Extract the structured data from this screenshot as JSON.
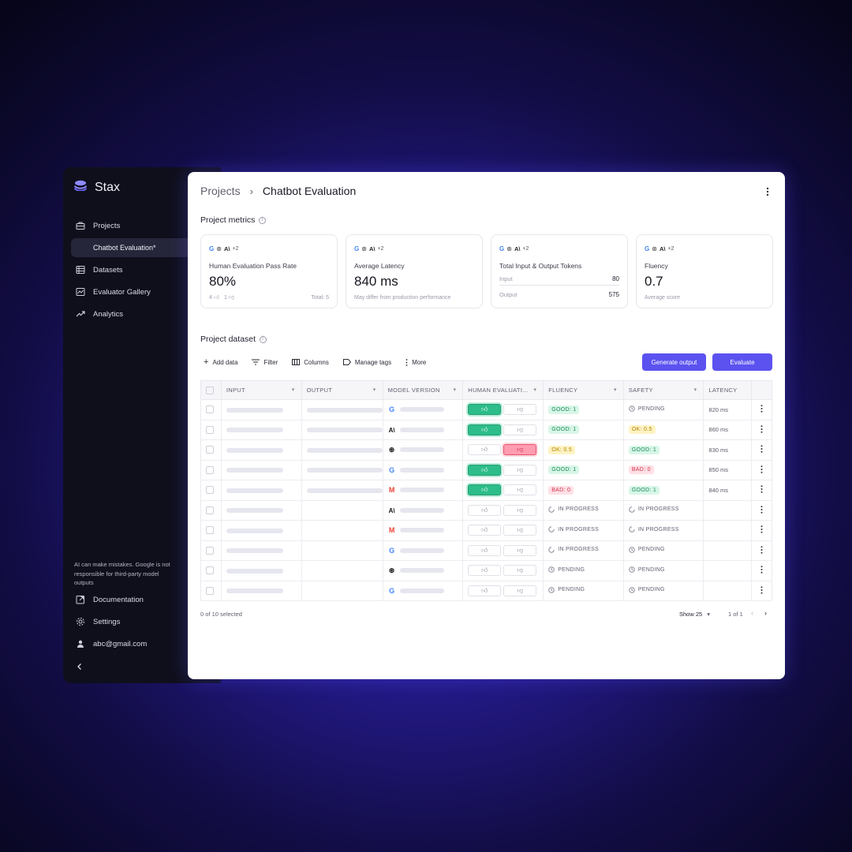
{
  "app": {
    "name": "Stax"
  },
  "sidebar": {
    "items": [
      {
        "label": "Projects",
        "icon": "briefcase-icon"
      },
      {
        "label": "Chatbot Evaluation*",
        "sub": true
      },
      {
        "label": "Datasets",
        "icon": "table-icon"
      },
      {
        "label": "Evaluator Gallery",
        "icon": "chart-gallery-icon"
      },
      {
        "label": "Analytics",
        "icon": "trending-icon"
      }
    ],
    "disclaimer": "AI can make mistakes. Google is not responsible for third-party model outputs",
    "bottom": [
      {
        "label": "Documentation",
        "icon": "external-link-icon"
      },
      {
        "label": "Settings",
        "icon": "gear-icon"
      },
      {
        "label": "abc@gmail.com",
        "icon": "user-icon"
      }
    ]
  },
  "header": {
    "root": "Projects",
    "current": "Chatbot Evaluation"
  },
  "metrics": {
    "title": "Project metrics",
    "chips_more": "+2",
    "cards": [
      {
        "label": "Human Evaluation Pass Rate",
        "value": "80%",
        "up": "4",
        "down": "1",
        "total": "Total: 5"
      },
      {
        "label": "Average Latency",
        "value": "840 ms",
        "note": "May differ from production performance"
      },
      {
        "label": "Total Input & Output Tokens",
        "input_label": "Input",
        "input_value": "80",
        "output_label": "Output",
        "output_value": "575"
      },
      {
        "label": "Fluency",
        "value": "0.7",
        "note": "Average score"
      }
    ]
  },
  "dataset": {
    "title": "Project dataset",
    "toolbar": {
      "add": "Add data",
      "filter": "Filter",
      "columns": "Columns",
      "tags": "Manage tags",
      "more": "More"
    },
    "generate_label": "Generate output",
    "evaluate_label": "Evaluate",
    "columns": [
      "INPUT",
      "OUTPUT",
      "MODEL VERSION",
      "HUMAN EVALUATI...",
      "FLUENCY",
      "SAFETY",
      "LATENCY"
    ],
    "rows": [
      {
        "model": "google",
        "output": true,
        "human": "up",
        "fluency": {
          "kind": "good",
          "text": "GOOD: 1"
        },
        "safety": {
          "kind": "pending",
          "text": "PENDING"
        },
        "latency": "820 ms"
      },
      {
        "model": "anthropic",
        "output": true,
        "human": "up",
        "fluency": {
          "kind": "good",
          "text": "GOOD: 1"
        },
        "safety": {
          "kind": "ok",
          "text": "OK: 0.5"
        },
        "latency": "860 ms"
      },
      {
        "model": "openai",
        "output": true,
        "human": "down",
        "fluency": {
          "kind": "ok",
          "text": "OK: 0.5"
        },
        "safety": {
          "kind": "good",
          "text": "GOOD: 1"
        },
        "latency": "830 ms"
      },
      {
        "model": "google",
        "output": true,
        "human": "up",
        "fluency": {
          "kind": "good",
          "text": "GOOD: 1"
        },
        "safety": {
          "kind": "bad",
          "text": "BAD: 0"
        },
        "latency": "850 ms"
      },
      {
        "model": "gmail",
        "output": true,
        "human": "up",
        "fluency": {
          "kind": "bad",
          "text": "BAD: 0"
        },
        "safety": {
          "kind": "good",
          "text": "GOOD: 1"
        },
        "latency": "840 ms"
      },
      {
        "model": "anthropic",
        "output": false,
        "human": "none",
        "fluency": {
          "kind": "progress",
          "text": "IN PROGRESS"
        },
        "safety": {
          "kind": "progress",
          "text": "IN PROGRESS"
        },
        "latency": ""
      },
      {
        "model": "gmail",
        "output": false,
        "human": "none",
        "fluency": {
          "kind": "progress",
          "text": "IN PROGRESS"
        },
        "safety": {
          "kind": "progress",
          "text": "IN PROGRESS"
        },
        "latency": ""
      },
      {
        "model": "google",
        "output": false,
        "human": "none",
        "fluency": {
          "kind": "progress",
          "text": "IN PROGRESS"
        },
        "safety": {
          "kind": "pending",
          "text": "PENDING"
        },
        "latency": ""
      },
      {
        "model": "openai",
        "output": false,
        "human": "none",
        "fluency": {
          "kind": "pending",
          "text": "PENDING"
        },
        "safety": {
          "kind": "pending",
          "text": "PENDING"
        },
        "latency": ""
      },
      {
        "model": "google",
        "output": false,
        "human": "none",
        "fluency": {
          "kind": "pending",
          "text": "PENDING"
        },
        "safety": {
          "kind": "pending",
          "text": "PENDING"
        },
        "latency": ""
      }
    ],
    "selected": "0 of 10 selected",
    "show": "Show 25",
    "page": "1 of 1"
  },
  "colors": {
    "accent": "#5b52f0",
    "good": "#1b8b5a",
    "ok": "#b38100",
    "bad": "#d2344e",
    "sidebar": "#0f0f1c"
  }
}
